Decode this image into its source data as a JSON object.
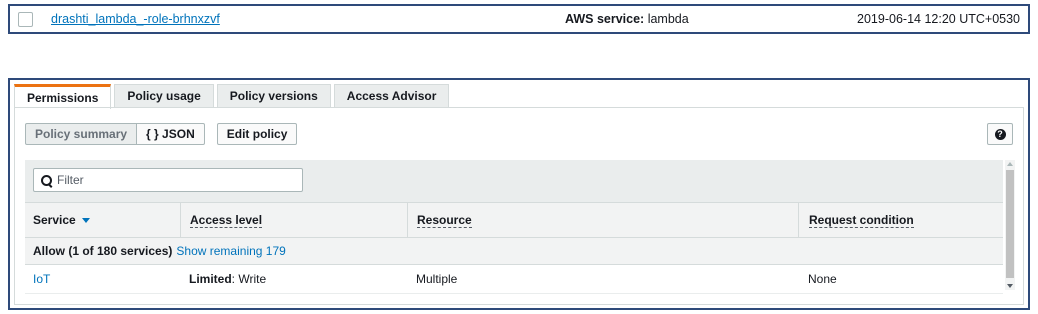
{
  "role": {
    "name": "drashti_lambda_-role-brhnxzvf",
    "service_label": "AWS service:",
    "service_value": "lambda",
    "created": "2019-06-14 12:20 UTC+0530"
  },
  "tabs": [
    {
      "label": "Permissions"
    },
    {
      "label": "Policy usage"
    },
    {
      "label": "Policy versions"
    },
    {
      "label": "Access Advisor"
    }
  ],
  "toolbar": {
    "summary_label": "Policy summary",
    "json_label": "{ } JSON",
    "edit_label": "Edit policy",
    "help_icon": "question-circle-icon"
  },
  "filter": {
    "placeholder": "Filter"
  },
  "columns": {
    "service": "Service",
    "access_level": "Access level",
    "resource": "Resource",
    "condition": "Request condition"
  },
  "group": {
    "label": "Allow (1 of 180 services)",
    "link": "Show remaining 179"
  },
  "rows": [
    {
      "service": "IoT",
      "level_bold": "Limited",
      "level_rest": ": Write",
      "resource": "Multiple",
      "condition": "None"
    }
  ],
  "colors": {
    "accent": "#ec7211",
    "link": "#0073bb",
    "frame": "#2e4a7a"
  }
}
